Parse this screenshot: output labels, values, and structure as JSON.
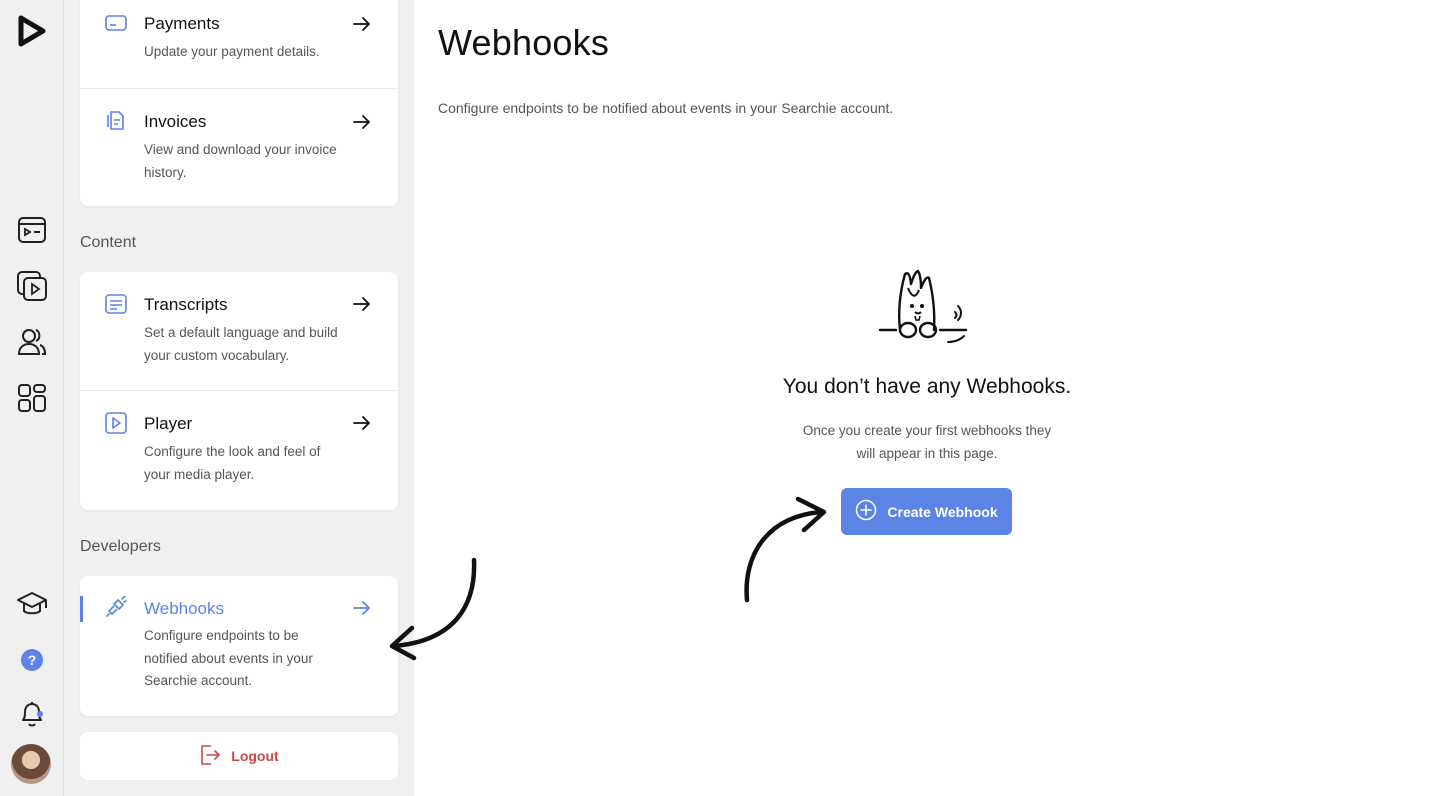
{
  "rail": {
    "icons": [
      "logo-icon",
      "projects-icon",
      "media-library-icon",
      "users-icon",
      "apps-icon",
      "academy-icon",
      "help-icon",
      "notifications-icon",
      "avatar"
    ]
  },
  "settings": {
    "billing_items": [
      {
        "title": "Payments",
        "desc": "Update your payment details.",
        "icon": "credit-card-icon"
      },
      {
        "title": "Invoices",
        "desc": "View and download your invoice history.",
        "icon": "invoice-icon"
      }
    ],
    "content_label": "Content",
    "content_items": [
      {
        "title": "Transcripts",
        "desc": "Set a default language and build your custom vocabulary.",
        "icon": "transcript-icon"
      },
      {
        "title": "Player",
        "desc": "Configure the look and feel of your media player.",
        "icon": "player-icon"
      }
    ],
    "developers_label": "Developers",
    "developer_items": [
      {
        "title": "Webhooks",
        "desc": "Configure endpoints to be notified about events in your Searchie account.",
        "icon": "webhook-icon",
        "active": true
      }
    ],
    "logout_label": "Logout"
  },
  "main": {
    "title": "Webhooks",
    "subtitle": "Configure endpoints to be notified about events in your Searchie account.",
    "empty_title": "You don’t have any Webhooks.",
    "empty_desc_line1": "Once you create your first webhooks they",
    "empty_desc_line2": "will appear in this page.",
    "create_button": "Create Webhook"
  },
  "colors": {
    "accent": "#5c84e6",
    "logout": "#c9474a",
    "panel_bg": "#f0f0f0"
  }
}
